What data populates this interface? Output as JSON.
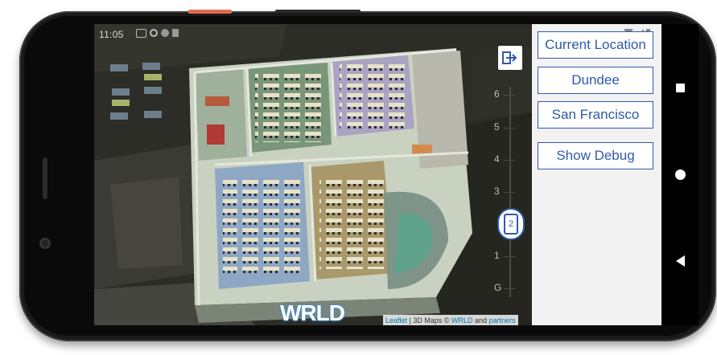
{
  "status_bar": {
    "time": "11:05",
    "icons": [
      "camera-icon",
      "sync-icon",
      "dnd-icon",
      "sd-card-icon"
    ],
    "system_icons": [
      "wifi-icon",
      "signal-icon",
      "battery-icon"
    ]
  },
  "map": {
    "exit_indoor_icon": "exit-indoor-icon",
    "floor_labels": [
      "6",
      "5",
      "4",
      "3",
      "2",
      "1",
      "G"
    ],
    "selected_floor": "2",
    "logo_text": "WRLD",
    "attribution": {
      "leaflet": "Leaflet",
      "sep1": " | 3D Maps © ",
      "wrld": "WRLD",
      "and": " and ",
      "partners": "partners"
    }
  },
  "panel": {
    "buttons": [
      "Current Location",
      "Dundee",
      "San Francisco",
      "Show Debug"
    ]
  },
  "nav": {
    "icons": [
      "overview-icon",
      "home-icon",
      "back-icon"
    ]
  },
  "colors": {
    "accent": "#2f5aa8",
    "panel_bg": "#f2f2f2"
  }
}
